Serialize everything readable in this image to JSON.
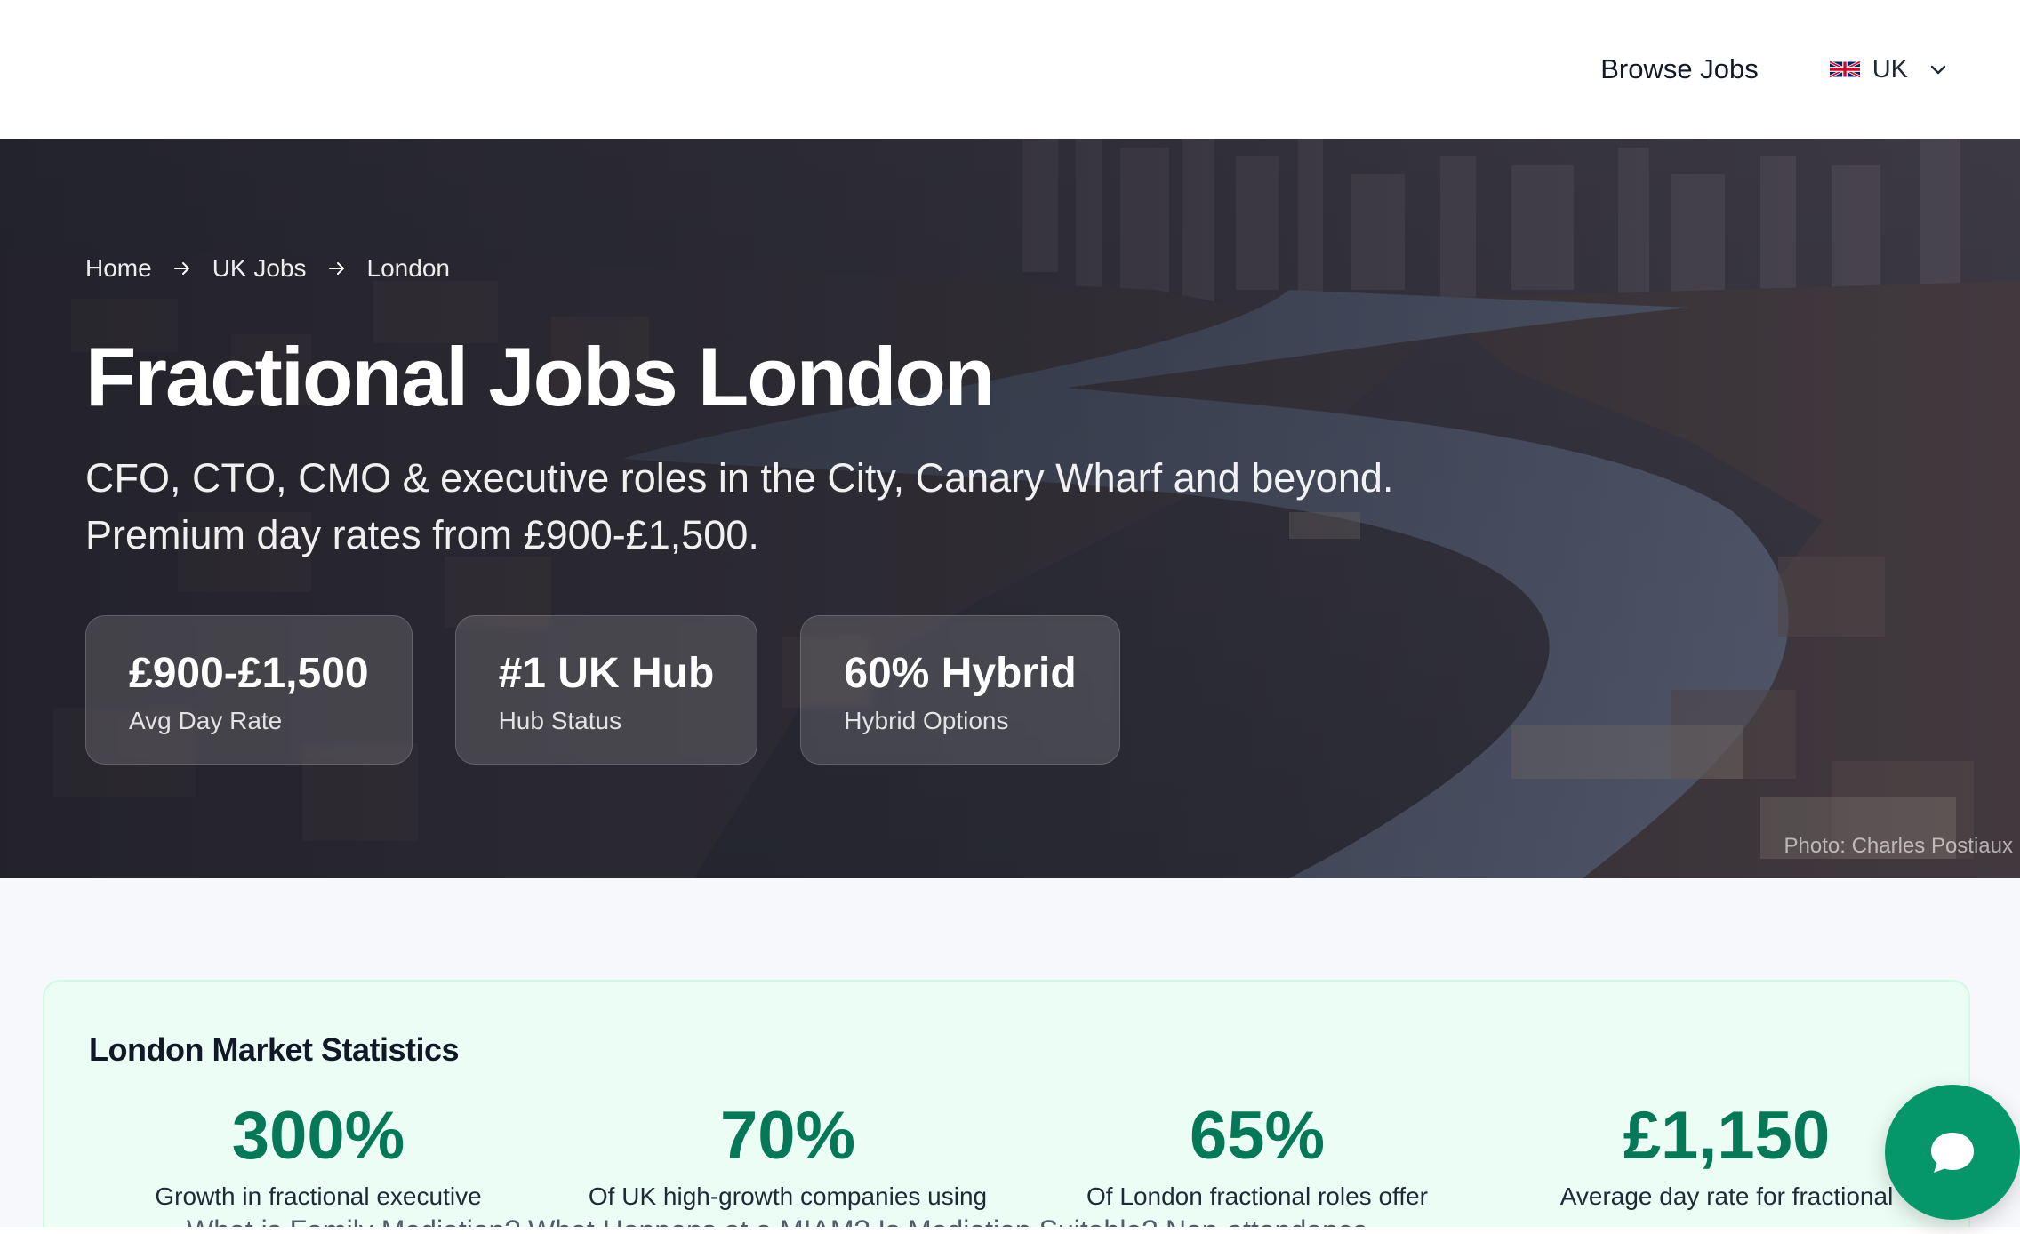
{
  "header": {
    "browse_jobs_label": "Browse Jobs",
    "locale_label": "UK",
    "flag_icon": "uk-flag-icon",
    "dropdown_icon": "chevron-down-icon"
  },
  "hero": {
    "breadcrumb": [
      "Home",
      "UK Jobs",
      "London"
    ],
    "breadcrumb_separator_icon": "arrow-right-icon",
    "title": "Fractional Jobs London",
    "subtitle_line1": "CFO, CTO, CMO & executive roles in the City, Canary Wharf and beyond.",
    "subtitle_line2": "Premium day rates from £900-£1,500.",
    "stats": [
      {
        "value": "£900-£1,500",
        "label": "Avg Day Rate"
      },
      {
        "value": "#1 UK Hub",
        "label": "Hub Status"
      },
      {
        "value": "60% Hybrid",
        "label": "Hybrid Options"
      }
    ],
    "photo_credit": "Photo: Charles Postiaux"
  },
  "market": {
    "title": "London Market Statistics",
    "metrics": [
      {
        "value": "300%",
        "description": "Growth in fractional executive"
      },
      {
        "value": "70%",
        "description": "Of UK high-growth companies using"
      },
      {
        "value": "65%",
        "description": "Of London fractional roles offer"
      },
      {
        "value": "£1,150",
        "description": "Average day rate for fractional"
      }
    ]
  },
  "overflow_text": "What is Family Mediation?  What Happens at a MIAM?  Is Mediation Suitable?  Non-attendance",
  "chat": {
    "icon": "chat-bubble-icon"
  },
  "colors": {
    "accent": "#047857",
    "chat_button": "#059669",
    "market_background": "#ecfdf5"
  }
}
